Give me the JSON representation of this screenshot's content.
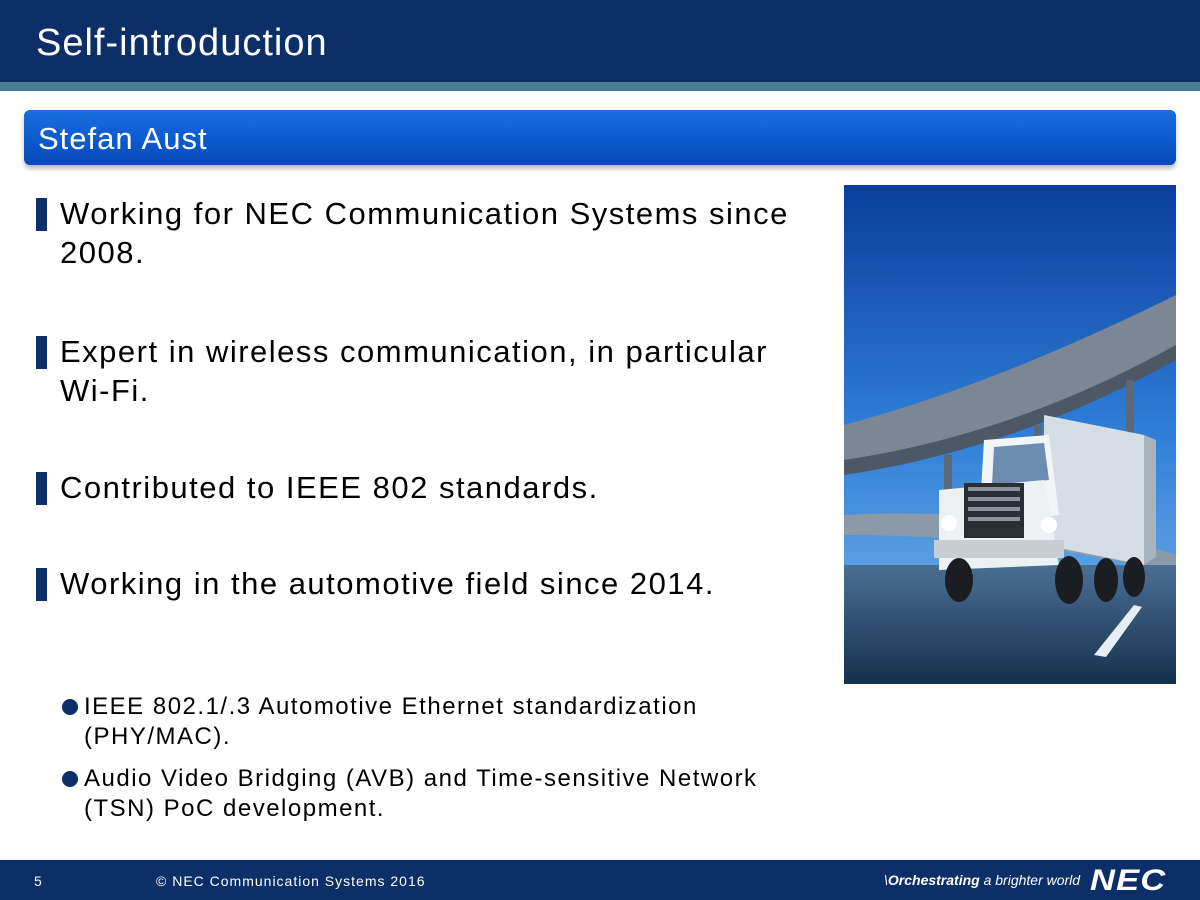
{
  "header": {
    "title": "Self-introduction"
  },
  "section": {
    "subtitle": "Stefan Aust"
  },
  "bullets": [
    {
      "text": "Working for NEC Communication Systems since 2008."
    },
    {
      "text": "Expert in wireless communication, in particular Wi-Fi."
    },
    {
      "text": "Contributed to IEEE 802 standards."
    },
    {
      "text": "Working in the automotive field since 2014."
    }
  ],
  "sub_bullets": [
    {
      "text": "IEEE 802.1/.3 Automotive Ethernet standardization (PHY/MAC)."
    },
    {
      "text": "Audio Video Bridging (AVB) and Time-sensitive Network (TSN) PoC development."
    }
  ],
  "footer": {
    "page_number": "5",
    "copyright": "© NEC Communication Systems 2016",
    "tagline_bold": "Orchestrating",
    "tagline_rest": " a brighter world",
    "logo": "NEC"
  },
  "colors": {
    "title_bar": "#0b2f66",
    "subtitle_bar": "#0a58cd",
    "bullet_marker": "#0b2f66"
  }
}
